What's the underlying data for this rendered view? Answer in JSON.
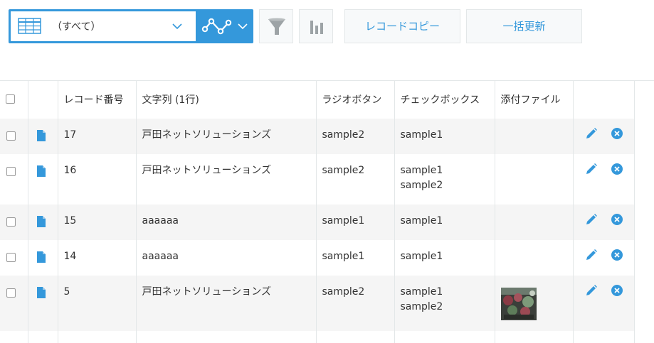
{
  "toolbar": {
    "view_label": "（すべて）",
    "copy_label": "レコードコピー",
    "bulk_label": "一括更新"
  },
  "table": {
    "headers": {
      "record_no": "レコード番号",
      "text": "文字列 (1行)",
      "radio": "ラジオボタン",
      "checkbox": "チェックボックス",
      "attachment": "添付ファイル"
    },
    "rows": [
      {
        "record_no": "17",
        "text": "戸田ネットソリューションズ",
        "radio": "sample2",
        "checkbox": [
          "sample1"
        ],
        "has_attachment": false
      },
      {
        "record_no": "16",
        "text": "戸田ネットソリューションズ",
        "radio": "sample2",
        "checkbox": [
          "sample1",
          "sample2"
        ],
        "has_attachment": false
      },
      {
        "record_no": "15",
        "text": "aaaaaa",
        "radio": "sample1",
        "checkbox": [
          "sample1"
        ],
        "has_attachment": false
      },
      {
        "record_no": "14",
        "text": "aaaaaa",
        "radio": "sample1",
        "checkbox": [
          "sample1"
        ],
        "has_attachment": false
      },
      {
        "record_no": "5",
        "text": "戸田ネットソリューションズ",
        "radio": "sample2",
        "checkbox": [
          "sample1",
          "sample2"
        ],
        "has_attachment": true
      }
    ]
  },
  "colors": {
    "accent": "#3498db",
    "border": "#e3e7e8",
    "row_alt": "#f5f5f5"
  }
}
